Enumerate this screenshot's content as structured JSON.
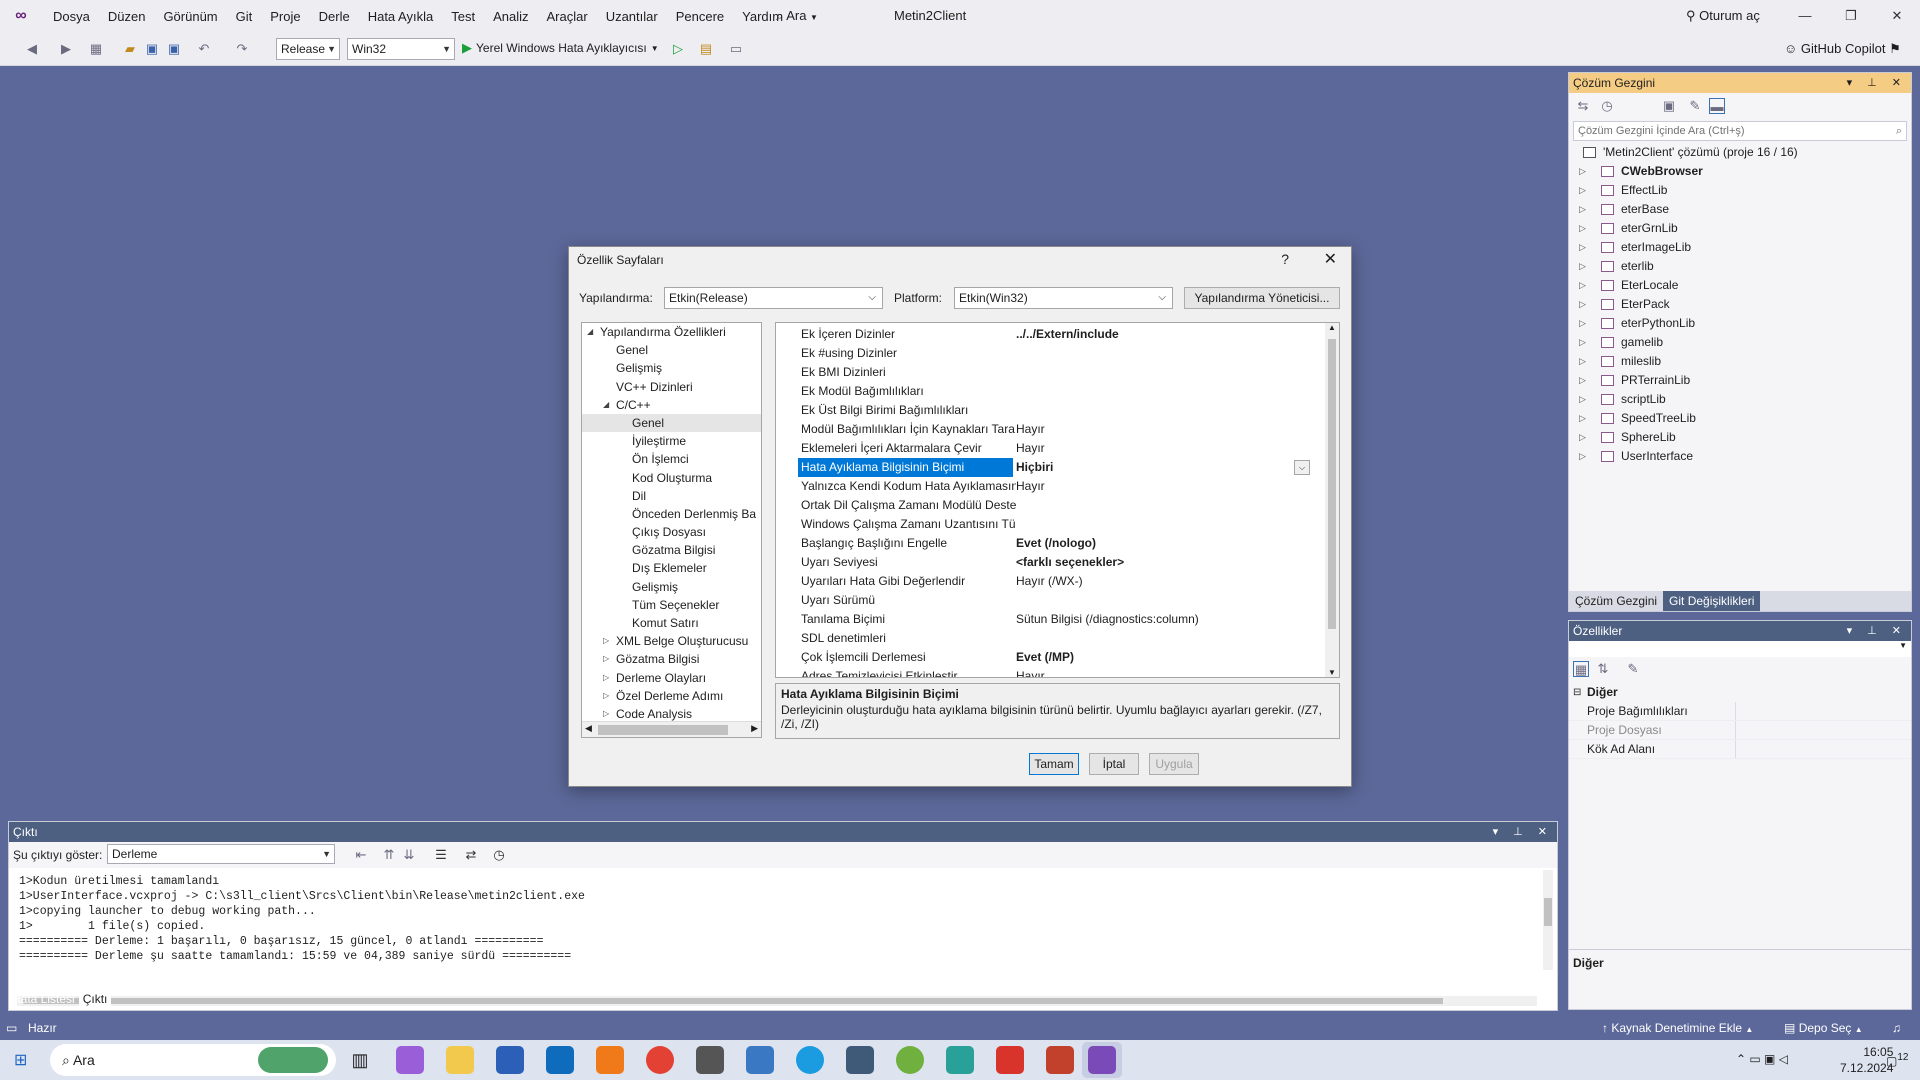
{
  "menubar": {
    "items": [
      "Dosya",
      "Düzen",
      "Görünüm",
      "Git",
      "Proje",
      "Derle",
      "Hata Ayıkla",
      "Test",
      "Analiz",
      "Araçlar",
      "Uzantılar",
      "Pencere",
      "Yardım"
    ],
    "search_label": "Ara",
    "project_name": "Metin2Client",
    "signin_label": "Oturum aç"
  },
  "toolbar": {
    "config": "Release",
    "platform": "Win32",
    "run_label": "Yerel Windows Hata Ayıklayıcısı",
    "copilot_label": "GitHub Copilot"
  },
  "dialog": {
    "title": "Özellik Sayfaları",
    "config_label": "Yapılandırma:",
    "config_value": "Etkin(Release)",
    "platform_label": "Platform:",
    "platform_value": "Etkin(Win32)",
    "config_manager_button": "Yapılandırma Yöneticisi...",
    "tree": [
      {
        "label": "Yapılandırma Özellikleri",
        "level": 0,
        "exp": "open"
      },
      {
        "label": "Genel",
        "level": 1,
        "exp": ""
      },
      {
        "label": "Gelişmiş",
        "level": 1,
        "exp": ""
      },
      {
        "label": "VC++ Dizinleri",
        "level": 1,
        "exp": ""
      },
      {
        "label": "C/C++",
        "level": 1,
        "exp": "open"
      },
      {
        "label": "Genel",
        "level": 2,
        "exp": "",
        "selected": true
      },
      {
        "label": "İyileştirme",
        "level": 2,
        "exp": ""
      },
      {
        "label": "Ön İşlemci",
        "level": 2,
        "exp": ""
      },
      {
        "label": "Kod Oluşturma",
        "level": 2,
        "exp": ""
      },
      {
        "label": "Dil",
        "level": 2,
        "exp": ""
      },
      {
        "label": "Önceden Derlenmiş Ba",
        "level": 2,
        "exp": ""
      },
      {
        "label": "Çıkış Dosyası",
        "level": 2,
        "exp": ""
      },
      {
        "label": "Gözatma Bilgisi",
        "level": 2,
        "exp": ""
      },
      {
        "label": "Dış Eklemeler",
        "level": 2,
        "exp": ""
      },
      {
        "label": "Gelişmiş",
        "level": 2,
        "exp": ""
      },
      {
        "label": "Tüm Seçenekler",
        "level": 2,
        "exp": ""
      },
      {
        "label": "Komut Satırı",
        "level": 2,
        "exp": ""
      },
      {
        "label": "XML Belge Oluşturucusu",
        "level": 1,
        "exp": "closed"
      },
      {
        "label": "Gözatma Bilgisi",
        "level": 1,
        "exp": "closed"
      },
      {
        "label": "Derleme Olayları",
        "level": 1,
        "exp": "closed"
      },
      {
        "label": "Özel Derleme Adımı",
        "level": 1,
        "exp": "closed"
      },
      {
        "label": "Code Analysis",
        "level": 1,
        "exp": "closed"
      }
    ],
    "grid": [
      {
        "key": "Ek İçeren Dizinler",
        "value": "../../Extern/include",
        "bold": true
      },
      {
        "key": "Ek #using Dizinler",
        "value": "",
        "bold": false
      },
      {
        "key": "Ek BMI Dizinleri",
        "value": "",
        "bold": false
      },
      {
        "key": "Ek Modül Bağımlılıkları",
        "value": "",
        "bold": false
      },
      {
        "key": "Ek Üst Bilgi Birimi Bağımlılıkları",
        "value": "",
        "bold": false
      },
      {
        "key": "Modül Bağımlılıkları İçin Kaynakları Tara",
        "value": "Hayır",
        "bold": false
      },
      {
        "key": "Eklemeleri İçeri Aktarmalara Çevir",
        "value": "Hayır",
        "bold": false
      },
      {
        "key": "Hata Ayıklama Bilgisinin Biçimi",
        "value": "Hiçbiri",
        "bold": true,
        "selected": true
      },
      {
        "key": "Yalnızca Kendi Kodum Hata Ayıklamasın",
        "value": "Hayır",
        "bold": false
      },
      {
        "key": "Ortak Dil Çalışma Zamanı Modülü Deste",
        "value": "",
        "bold": false
      },
      {
        "key": "Windows Çalışma Zamanı Uzantısını Tül",
        "value": "",
        "bold": false
      },
      {
        "key": "Başlangıç Başlığını Engelle",
        "value": "Evet (/nologo)",
        "bold": true
      },
      {
        "key": "Uyarı Seviyesi",
        "value": "<farklı seçenekler>",
        "bold": true
      },
      {
        "key": "Uyarıları Hata Gibi Değerlendir",
        "value": "Hayır (/WX-)",
        "bold": false
      },
      {
        "key": "Uyarı Sürümü",
        "value": "",
        "bold": false
      },
      {
        "key": "Tanılama Biçimi",
        "value": "Sütun Bilgisi (/diagnostics:column)",
        "bold": false
      },
      {
        "key": "SDL denetimleri",
        "value": "",
        "bold": false
      },
      {
        "key": "Çok İşlemcili Derlemesi",
        "value": "Evet (/MP)",
        "bold": true
      },
      {
        "key": "Adres Temizleyicisi Etkinleştir",
        "value": "Hayır",
        "bold": false
      }
    ],
    "desc_title": "Hata Ayıklama Bilgisinin Biçimi",
    "desc_text": "Derleyicinin oluşturduğu hata ayıklama bilgisinin türünü belirtir. Uyumlu bağlayıcı ayarları gerekir.   (/Z7, /Zi, /ZI)",
    "ok_button": "Tamam",
    "cancel_button": "İptal",
    "apply_button": "Uygula"
  },
  "solution": {
    "title": "Çözüm Gezgini",
    "search_placeholder": "Çözüm Gezgini İçinde Ara (Ctrl+ş)",
    "root": "'Metin2Client' çözümü (proje 16 / 16)",
    "projects": [
      "CWebBrowser",
      "EffectLib",
      "eterBase",
      "eterGrnLib",
      "eterImageLib",
      "eterlib",
      "EterLocale",
      "EterPack",
      "eterPythonLib",
      "gamelib",
      "mileslib",
      "PRTerrainLib",
      "scriptLib",
      "SpeedTreeLib",
      "SphereLib",
      "UserInterface"
    ],
    "tab_active": "Çözüm Gezgini",
    "tab_other": "Git Değişiklikleri"
  },
  "properties": {
    "title": "Özellikler",
    "category": "Diğer",
    "rows": [
      "Proje Bağımlılıkları",
      "Proje Dosyası",
      "Kök Ad Alanı"
    ],
    "desc_title": "Diğer"
  },
  "output": {
    "title": "Çıktı",
    "show_label": "Şu çıktıyı göster:",
    "source": "Derleme",
    "lines": [
      "1>Kodun üretilmesi tamamlandı",
      "1>UserInterface.vcxproj -> C:\\s3ll_client\\Srcs\\Client\\bin\\Release\\metin2client.exe",
      "1>copying launcher to debug working path...",
      "1>        1 file(s) copied.",
      "========== Derleme: 1 başarılı, 0 başarısız, 15 güncel, 0 atlandı ==========",
      "========== Derleme şu saatte tamamlandı: 15:59 ve 04,389 saniye sürdü =========="
    ],
    "tab_errors": "Hata Listesi",
    "tab_output": "Çıktı"
  },
  "status": {
    "ready": "Hazır",
    "source_control": "Kaynak Denetimine Ekle",
    "repo": "Depo Seç"
  },
  "taskbar": {
    "search": "Ara",
    "time": "16:05",
    "date": "7.12.2024",
    "notifications": "12"
  },
  "colors": {
    "accent": "#0078d7",
    "vs_purple": "#68217a",
    "status_bar": "#5c6899",
    "active_tool_header": "#f5cc84"
  }
}
